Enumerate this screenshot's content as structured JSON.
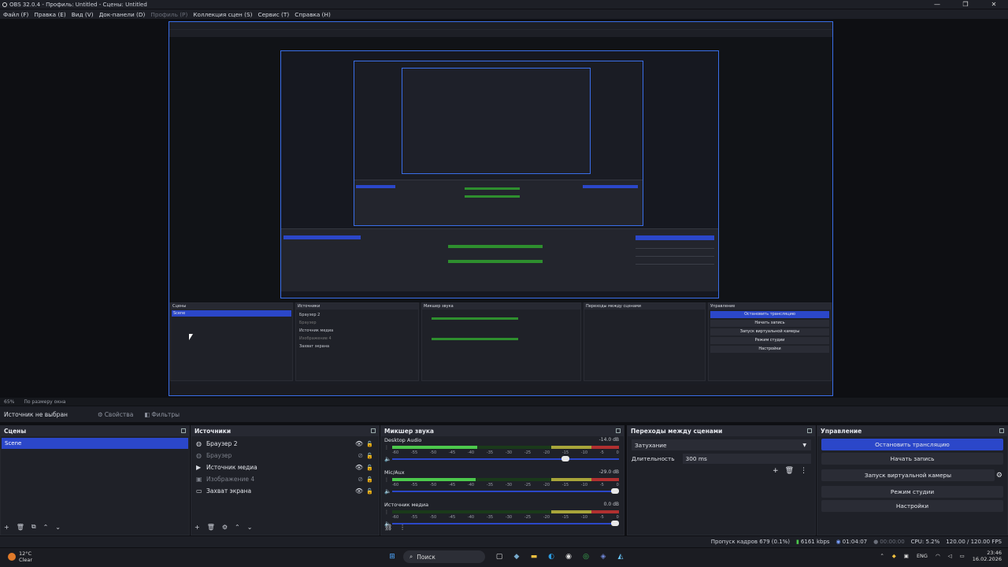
{
  "window": {
    "title": "OBS 32.0.4 - Профиль: Untitled - Сцены: Untitled",
    "controls": [
      "—",
      "❐",
      "✕"
    ]
  },
  "menu": [
    {
      "label": "Файл (F)",
      "disabled": false
    },
    {
      "label": "Правка (E)",
      "disabled": false
    },
    {
      "label": "Вид (V)",
      "disabled": false
    },
    {
      "label": "Док-панели (D)",
      "disabled": false
    },
    {
      "label": "Профиль (P)",
      "disabled": true
    },
    {
      "label": "Коллекция сцен (S)",
      "disabled": false
    },
    {
      "label": "Сервис (T)",
      "disabled": false
    },
    {
      "label": "Справка (H)",
      "disabled": false
    }
  ],
  "preview": {
    "zoom": "65%",
    "fit_mode": "По размеру окна"
  },
  "source_toolbar": {
    "no_source": "Источник не выбран",
    "properties": "Свойства",
    "filters": "Фильтры"
  },
  "docks": {
    "scenes": {
      "title": "Сцены",
      "items": [
        "Scene"
      ],
      "footer_icons": [
        "+",
        "🗑",
        "⧉",
        "⌃",
        "⌄"
      ]
    },
    "sources": {
      "title": "Источники",
      "items": [
        {
          "icon": "globe-icon",
          "glyph": "◍",
          "label": "Браузер 2",
          "visible": true
        },
        {
          "icon": "globe-icon",
          "glyph": "◍",
          "label": "Браузер",
          "visible": false
        },
        {
          "icon": "play-icon",
          "glyph": "▶",
          "label": "Источник медиа",
          "visible": true
        },
        {
          "icon": "image-icon",
          "glyph": "▣",
          "label": "Изображение 4",
          "visible": false
        },
        {
          "icon": "monitor-icon",
          "glyph": "▭",
          "label": "Захват экрана",
          "visible": true
        }
      ],
      "footer_icons": [
        "+",
        "🗑",
        "⚙",
        "⌃",
        "⌄"
      ]
    },
    "mixer": {
      "title": "Микшер звука",
      "scale": [
        "-60",
        "-55",
        "-50",
        "-45",
        "-40",
        "-35",
        "-30",
        "-25",
        "-20",
        "-15",
        "-10",
        "-5",
        "0"
      ],
      "channels": [
        {
          "name": "Desktop Audio",
          "db": "-14.0 dB",
          "level": 0.47,
          "volume": 0.78
        },
        {
          "name": "Mic/Aux",
          "db": "-29.0 dB",
          "level": 0.46,
          "volume": 1.0
        },
        {
          "name": "Источник медиа",
          "db": "0.0 dB",
          "level": 0.0,
          "volume": 1.0
        }
      ]
    },
    "transitions": {
      "title": "Переходы между сценами",
      "selected": "Затухание",
      "duration_label": "Длительность",
      "duration_value": "300 ms"
    },
    "controls": {
      "title": "Управление",
      "buttons": [
        "Остановить трансляцию",
        "Начать запись",
        "Запуск виртуальной камеры",
        "Режим студии",
        "Настройки"
      ]
    }
  },
  "status": {
    "dropped": "Пропуск кадров 679 (0.1%)",
    "bitrate": "6161 kbps",
    "stream_time": "01:04:07",
    "rec_time": "00:00:00",
    "cpu": "CPU: 5.2%",
    "fps": "120.00 / 120.00 FPS"
  },
  "taskbar": {
    "weather_temp": "12°C",
    "weather_desc": "Clear",
    "search": "Поиск",
    "lang": "ENG",
    "time": "23:46",
    "date": "16.02.2026"
  },
  "colors": {
    "accent": "#2b47c9",
    "preview_border": "#3a6ee8",
    "meter_green": "#4cc94c",
    "meter_yellow": "#a8a53a",
    "meter_red": "#b03030"
  }
}
